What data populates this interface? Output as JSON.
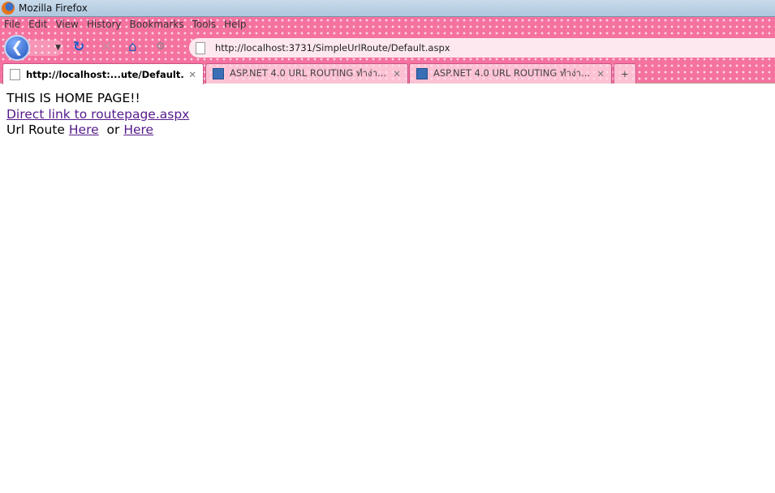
{
  "window": {
    "title": "Mozilla Firefox"
  },
  "menu": [
    "File",
    "Edit",
    "View",
    "History",
    "Bookmarks",
    "Tools",
    "Help"
  ],
  "nav": {
    "url": "http://localhost:3731/SimpleUrlRoute/Default.aspx"
  },
  "tabs": [
    {
      "label": "http://localhost:...ute/Default.aspx",
      "active": true
    },
    {
      "label": "ASP.NET 4.0 URL ROUTING ทำง่า...",
      "active": false
    },
    {
      "label": "ASP.NET 4.0 URL ROUTING ทำง่า...",
      "active": false
    }
  ],
  "page": {
    "heading": "THIS IS HOME PAGE!!",
    "direct_link": "Direct link to routepage.aspx",
    "url_route_label": "Url Route",
    "link1": "Here",
    "or": "or",
    "link2": "Here"
  },
  "colors": {
    "chrome": "#f5729f",
    "link": "#551a8b"
  }
}
